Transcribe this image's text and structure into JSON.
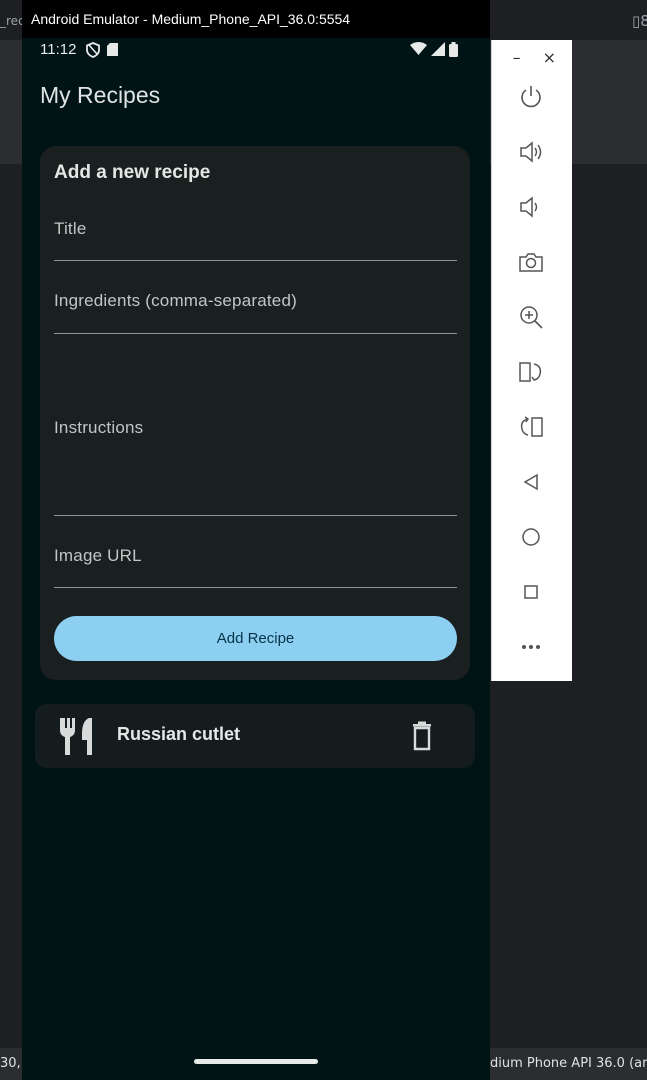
{
  "ide": {
    "left_edge_text": "_rec",
    "bottom_left_text": "30, (",
    "bottom_right_text": "dium Phone API 36.0 (ar",
    "top_right_glyph": "▯8"
  },
  "emulator": {
    "window_title": "Android Emulator - Medium_Phone_API_36.0:5554",
    "toolbar": {
      "minimize": "–",
      "close": "×",
      "buttons": [
        "power-icon",
        "volume-up-icon",
        "volume-down-icon",
        "camera-icon",
        "zoom-icon",
        "rotate-left-icon",
        "rotate-right-icon",
        "back-icon",
        "home-icon",
        "overview-icon",
        "more-icon"
      ]
    }
  },
  "status_bar": {
    "time": "11:12"
  },
  "app": {
    "title": "My Recipes",
    "form": {
      "heading": "Add a new recipe",
      "title_label": "Title",
      "ingredients_label": "Ingredients (comma-separated)",
      "instructions_label": "Instructions",
      "image_url_label": "Image URL",
      "submit_label": "Add Recipe"
    },
    "recipes": [
      {
        "title": "Russian cutlet"
      }
    ]
  },
  "colors": {
    "screen_bg": "#001416",
    "card_bg": "#1a1f20",
    "accent": "#8ccff0",
    "accent_text": "#06334a"
  }
}
